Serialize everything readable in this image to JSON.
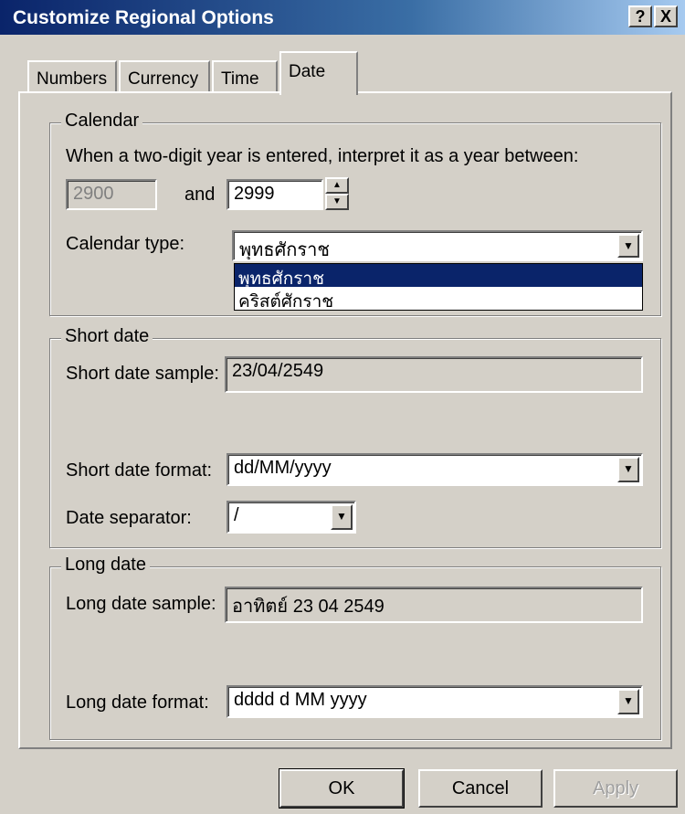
{
  "window": {
    "title": "Customize Regional Options",
    "help_label": "?",
    "close_label": "X"
  },
  "tabs": [
    {
      "label": "Numbers"
    },
    {
      "label": "Currency"
    },
    {
      "label": "Time"
    },
    {
      "label": "Date",
      "active": true
    }
  ],
  "calendar": {
    "legend": "Calendar",
    "instruction": "When a two-digit year is entered, interpret it as a year between:",
    "year_from": "2900",
    "and_label": "and",
    "year_to": "2999",
    "type_label": "Calendar type:",
    "type_value": "พุทธศักราช",
    "type_options": [
      "พุทธศักราช",
      "คริสต์ศักราช"
    ]
  },
  "short_date": {
    "legend": "Short date",
    "sample_label": "Short date sample:",
    "sample_value": "23/04/2549",
    "format_label": "Short date format:",
    "format_value": "dd/MM/yyyy",
    "separator_label": "Date separator:",
    "separator_value": "/"
  },
  "long_date": {
    "legend": "Long date",
    "sample_label": "Long date sample:",
    "sample_value": "อาทิตย์ 23 04 2549",
    "format_label": "Long date format:",
    "format_value": "dddd d MM yyyy"
  },
  "buttons": {
    "ok": "OK",
    "cancel": "Cancel",
    "apply": "Apply"
  }
}
